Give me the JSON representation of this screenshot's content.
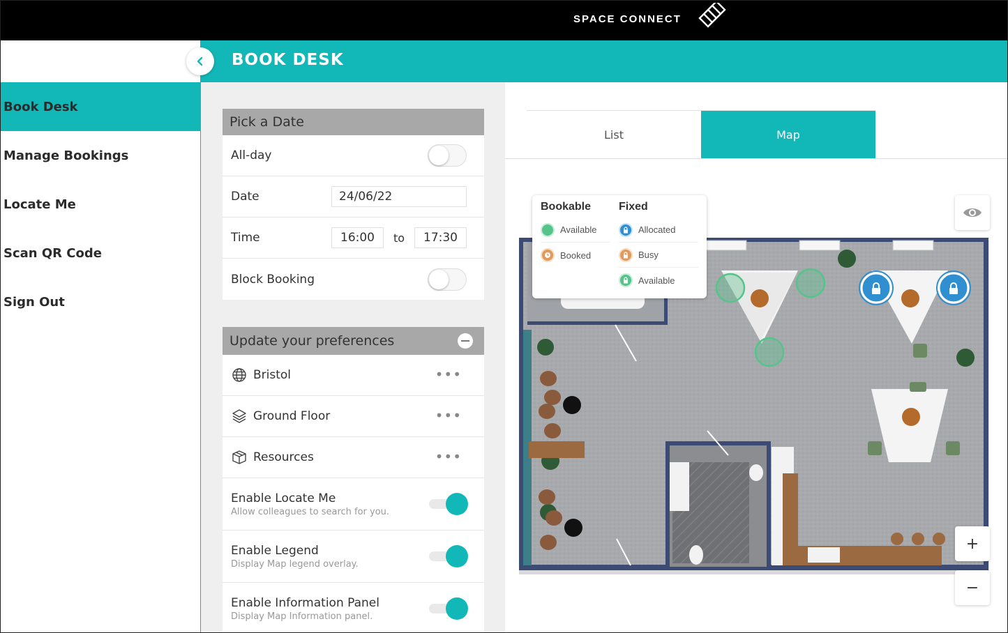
{
  "brand": {
    "name": "SPACE CONNECT"
  },
  "header": {
    "title": "BOOK DESK"
  },
  "sidebar": {
    "items": [
      {
        "label": "Book Desk",
        "active": true
      },
      {
        "label": "Manage Bookings"
      },
      {
        "label": "Locate Me"
      },
      {
        "label": "Scan QR Code"
      },
      {
        "label": "Sign Out"
      }
    ]
  },
  "date_card": {
    "title": "Pick a Date",
    "allday_label": "All-day",
    "allday_on": false,
    "date_label": "Date",
    "date_value": "24/06/22",
    "time_label": "Time",
    "time_start": "16:00",
    "time_sep": "to",
    "time_end": "17:30",
    "block_label": "Block Booking",
    "block_on": false
  },
  "prefs_card": {
    "title": "Update your preferences",
    "location": "Bristol",
    "floor": "Ground Floor",
    "resources": "Resources",
    "locate_label": "Enable Locate Me",
    "locate_sub": "Allow colleagues to search for you.",
    "legend_label": "Enable Legend",
    "legend_sub": "Display Map legend overlay.",
    "info_label": "Enable Information Panel",
    "info_sub": "Display Map Information panel."
  },
  "tabs": {
    "list": "List",
    "map": "Map",
    "active": "map"
  },
  "legend": {
    "bookable_title": "Bookable",
    "bookable_available": "Available",
    "bookable_booked": "Booked",
    "fixed_title": "Fixed",
    "fixed_allocated": "Allocated",
    "fixed_busy": "Busy",
    "fixed_available": "Available"
  },
  "map_controls": {
    "zoom_in": "+",
    "zoom_out": "−"
  },
  "colors": {
    "accent": "#12b8b8",
    "available": "#55c48a",
    "booked": "#e29a5c",
    "allocated": "#2f8fd0",
    "busy": "#e29a5c"
  },
  "icons": [
    "chevron-left-icon",
    "globe-icon",
    "layers-icon",
    "box-icon",
    "eye-icon",
    "lock-icon",
    "clock-icon",
    "more-icon",
    "plus-icon",
    "minus-icon"
  ]
}
